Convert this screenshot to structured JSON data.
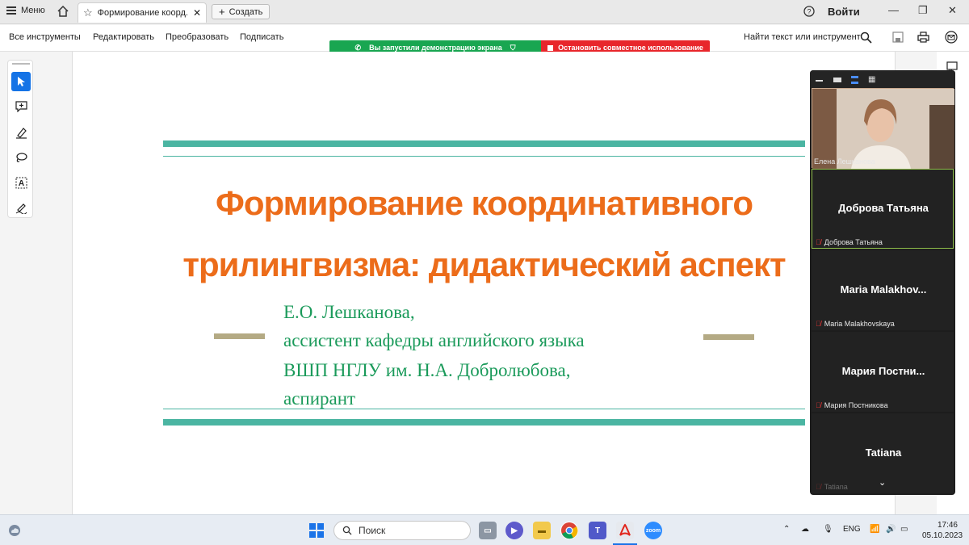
{
  "tabbar": {
    "menu_label": "Меню",
    "tab_title": "Формирование коорд...",
    "new_tab_label": "Создать",
    "signin_label": "Войти"
  },
  "toolbar": {
    "items": [
      "Все инструменты",
      "Редактировать",
      "Преобразовать",
      "Подписать"
    ],
    "find_label": "Найти текст или инструмент"
  },
  "share_banner": {
    "status_text": "Вы запустили демонстрацию экрана",
    "stop_text": "Остановить совместное использование"
  },
  "slide": {
    "title_line1": "Формирование координативного",
    "title_line2": "трилингвизма: дидактический аспект",
    "author_lines": [
      "Е.О. Лешканова,",
      "ассистент кафедры английского языка",
      "ВШП НГЛУ им. Н.А. Добролюбова,",
      "аспирант"
    ]
  },
  "zoom": {
    "participants": [
      {
        "display": "",
        "label": "Елена Лешканова",
        "video": true
      },
      {
        "display": "Доброва Татьяна",
        "label": "Доброва Татьяна",
        "video": false
      },
      {
        "display": "Maria Malakhov...",
        "label": "Maria Malakhovskaya",
        "video": false
      },
      {
        "display": "Мария Постни...",
        "label": "Мария Постникова",
        "video": false
      },
      {
        "display": "Tatiana",
        "label": "Tatiana",
        "video": false
      }
    ]
  },
  "taskbar": {
    "search_placeholder": "Поиск",
    "lang": "ENG",
    "time": "17:46",
    "date": "05.10.2023"
  },
  "colors": {
    "accent_teal": "#4bb5a2",
    "title_orange": "#ec6c1a",
    "subtitle_green": "#1a9a5a",
    "dash_khaki": "#b4aa84",
    "share_green": "#19a651",
    "share_red": "#e8262b"
  }
}
